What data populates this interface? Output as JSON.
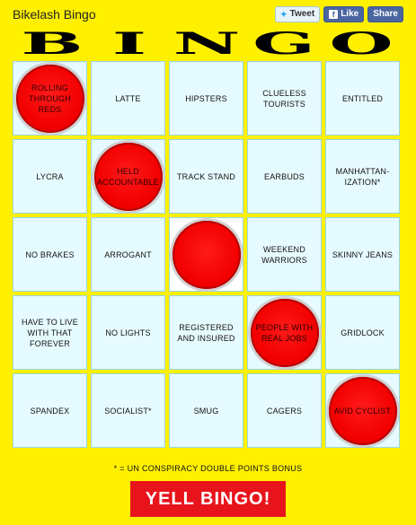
{
  "app": {
    "title": "Bikelash Bingo"
  },
  "social": {
    "tweet": "Tweet",
    "like": "Like",
    "share": "Share"
  },
  "heading": {
    "letters": [
      "B",
      "I",
      "N",
      "G",
      "O"
    ]
  },
  "board": {
    "rows": [
      [
        {
          "label": "ROLLING THROUGH REDS",
          "marked": true
        },
        {
          "label": "LATTE",
          "marked": false
        },
        {
          "label": "HIPSTERS",
          "marked": false
        },
        {
          "label": "CLUELESS TOURISTS",
          "marked": false
        },
        {
          "label": "ENTITLED",
          "marked": false
        }
      ],
      [
        {
          "label": "LYCRA",
          "marked": false
        },
        {
          "label": "HELD ACCOUNTABLE",
          "marked": true
        },
        {
          "label": "TRACK STAND",
          "marked": false
        },
        {
          "label": "EARBUDS",
          "marked": false
        },
        {
          "label": "MANHATTAN-IZATION*",
          "marked": false
        }
      ],
      [
        {
          "label": "NO BRAKES",
          "marked": false
        },
        {
          "label": "ARROGANT",
          "marked": false
        },
        {
          "label": "",
          "marked": true,
          "free": true
        },
        {
          "label": "WEEKEND WARRIORS",
          "marked": false
        },
        {
          "label": "SKINNY JEANS",
          "marked": false
        }
      ],
      [
        {
          "label": "HAVE TO LIVE WITH THAT FOREVER",
          "marked": false
        },
        {
          "label": "NO LIGHTS",
          "marked": false
        },
        {
          "label": "REGISTERED AND INSURED",
          "marked": false
        },
        {
          "label": "PEOPLE WITH REAL JOBS",
          "marked": true
        },
        {
          "label": "GRIDLOCK",
          "marked": false
        }
      ],
      [
        {
          "label": "SPANDEX",
          "marked": false
        },
        {
          "label": "SOCIALIST*",
          "marked": false
        },
        {
          "label": "SMUG",
          "marked": false
        },
        {
          "label": "CAGERS",
          "marked": false
        },
        {
          "label": "AVID CYCLIST",
          "marked": true
        }
      ]
    ]
  },
  "footnote": "* = UN CONSPIRACY DOUBLE POINTS BONUS",
  "action": {
    "yell_label": "YELL BINGO!"
  },
  "colors": {
    "background": "#FFF000",
    "cell": "#E6FBFF",
    "marker": "#F20000",
    "button": "#E8141C"
  }
}
